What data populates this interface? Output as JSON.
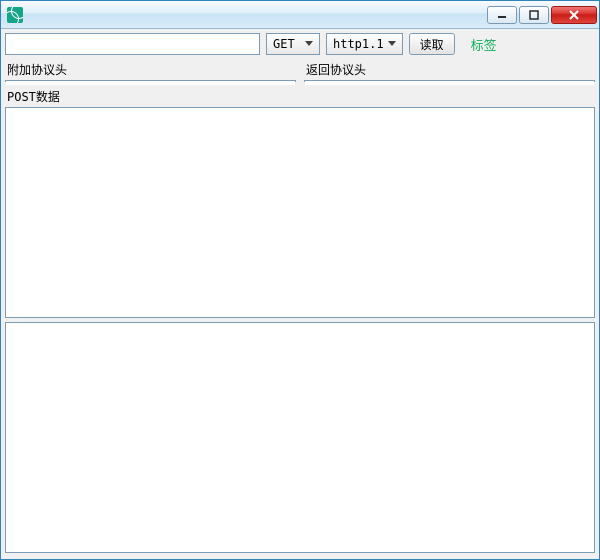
{
  "titlebar": {
    "title": ""
  },
  "toolbar": {
    "url_value": "",
    "method_selected": "GET",
    "http_version_selected": "http1.1",
    "fetch_button_label": "读取",
    "tag_label": "标签"
  },
  "sections": {
    "request_headers_label": "附加协议头",
    "response_headers_label": "返回协议头",
    "post_data_label": "POST数据",
    "request_headers_value": "",
    "response_headers_value": "",
    "post_data_value": "",
    "response_body_value": ""
  }
}
